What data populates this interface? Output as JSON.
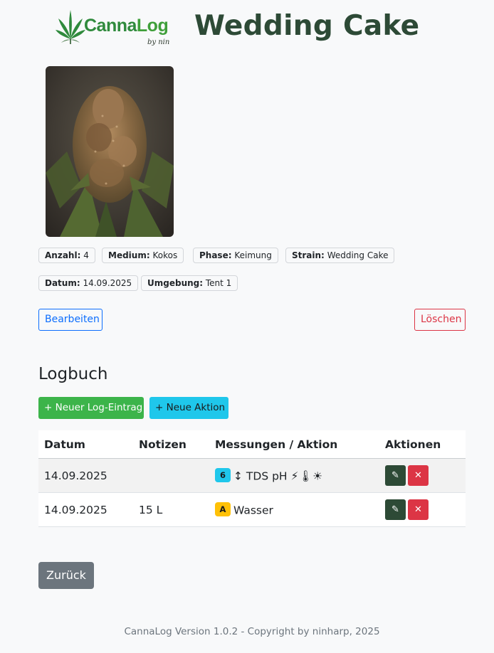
{
  "header": {
    "logo_brand_a": "Canna",
    "logo_brand_b": "Log",
    "logo_byline": "by nin",
    "title": "Wedding Cake"
  },
  "photo": {
    "icon": "cannabis-bud-photo"
  },
  "details": {
    "anzahl_label": "Anzahl:",
    "anzahl_value": "4",
    "medium_label": "Medium:",
    "medium_value": "Kokos",
    "phase_label": "Phase:",
    "phase_value": "Keimung",
    "strain_label": "Strain:",
    "strain_value": "Wedding Cake",
    "datum_label": "Datum:",
    "datum_value": "14.09.2025",
    "umgebung_label": "Umgebung:",
    "umgebung_value": "Tent 1"
  },
  "actions": {
    "edit_label": "Bearbeiten",
    "delete_label": "Löschen"
  },
  "logbook": {
    "title": "Logbuch",
    "new_log_label": "+ Neuer Log-Eintrag",
    "new_action_label": "+ Neue Aktion",
    "columns": [
      "Datum",
      "Notizen",
      "Messungen / Aktion",
      "Aktionen"
    ],
    "rows": [
      {
        "date": "14.09.2025",
        "notes": "",
        "badge": "6",
        "badge_color": "#1fc7eb",
        "measure": "↕ TDS pH ⚡🌡☀"
      },
      {
        "date": "14.09.2025",
        "notes": "15 L",
        "badge": "A",
        "badge_color": "#ffc107",
        "measure": "Wasser"
      }
    ],
    "row_edit_icon": "✎",
    "row_delete_icon": "✕"
  },
  "back_label": "Zurück",
  "footer": "CannaLog Version 1.0.2 - Copyright by ninharp, 2025",
  "colors": {
    "accent_green": "#2d4a36",
    "primary": "#0d6efd",
    "danger": "#dc3545",
    "success": "#3cb44a",
    "info": "#1fc7eb",
    "warning": "#ffc107",
    "secondary": "#6c757d"
  }
}
